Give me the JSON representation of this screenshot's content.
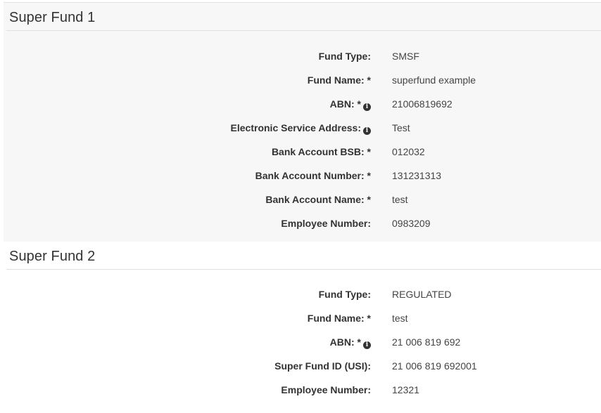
{
  "funds": [
    {
      "title": "Super Fund 1",
      "rows": [
        {
          "label": "Fund Type:",
          "value": "SMSF"
        },
        {
          "label": "Fund Name: *",
          "value": "superfund example"
        },
        {
          "label": "ABN: *",
          "value": "21006819692",
          "icon": "info-icon"
        },
        {
          "label": "Electronic Service Address:",
          "value": "Test",
          "icon": "info-icon"
        },
        {
          "label": "Bank Account BSB: *",
          "value": "012032"
        },
        {
          "label": "Bank Account Number: *",
          "value": "131231313"
        },
        {
          "label": "Bank Account Name: *",
          "value": "test"
        },
        {
          "label": "Employee Number:",
          "value": "0983209"
        }
      ]
    },
    {
      "title": "Super Fund 2",
      "rows": [
        {
          "label": "Fund Type:",
          "value": "REGULATED"
        },
        {
          "label": "Fund Name: *",
          "value": "test"
        },
        {
          "label": "ABN: *",
          "value": "21 006 819 692",
          "icon": "info-icon"
        },
        {
          "label": "Super Fund ID (USI):",
          "value": "21 006 819 692001"
        },
        {
          "label": "Employee Number:",
          "value": "12321"
        }
      ]
    }
  ],
  "info_glyph": "i"
}
